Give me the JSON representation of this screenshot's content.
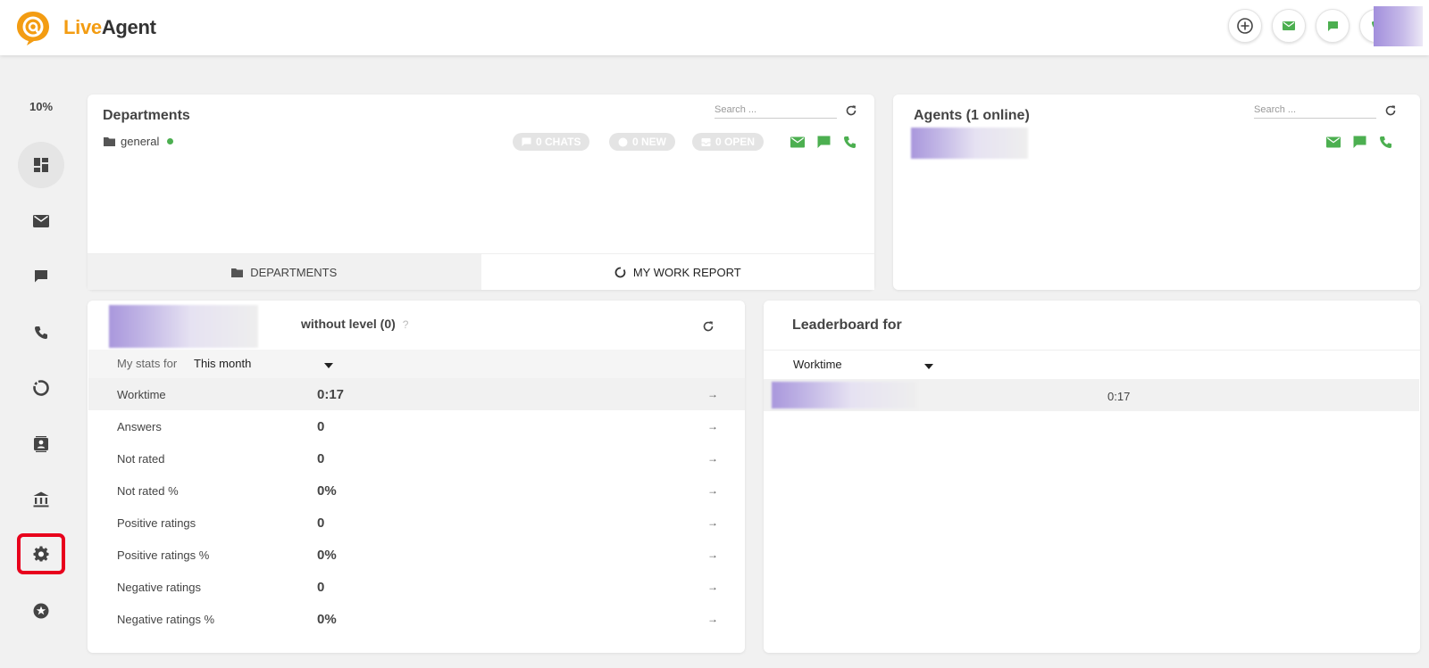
{
  "header": {
    "logo_live": "Live",
    "logo_agent": "Agent",
    "actions": [
      "add-icon",
      "mail-icon",
      "chat-icon",
      "phone-icon"
    ]
  },
  "sidebar": {
    "zoom": "10%",
    "items": [
      {
        "name": "dashboard",
        "icon": "dashboard-icon"
      },
      {
        "name": "tickets",
        "icon": "mail-icon"
      },
      {
        "name": "chats",
        "icon": "chat-icon"
      },
      {
        "name": "calls",
        "icon": "phone-icon"
      },
      {
        "name": "reports",
        "icon": "reports-icon"
      },
      {
        "name": "contacts",
        "icon": "contacts-icon"
      },
      {
        "name": "knowledgebase",
        "icon": "bank-icon"
      },
      {
        "name": "configuration",
        "icon": "gear-icon"
      },
      {
        "name": "plugins",
        "icon": "star-icon"
      }
    ]
  },
  "departments": {
    "title": "Departments",
    "search_placeholder": "Search ...",
    "department_name": "general",
    "chats": "0 CHATS",
    "new": "0 NEW",
    "open": "0 OPEN",
    "tabs": [
      "DEPARTMENTS",
      "MY WORK REPORT"
    ]
  },
  "agents": {
    "title": "Agents (1 online)",
    "search_placeholder": "Search ..."
  },
  "stats": {
    "level": "without level (0)",
    "help": "?",
    "filter_label": "My stats for",
    "filter_value": "This month",
    "rows": [
      {
        "label": "Worktime",
        "value": "0:17"
      },
      {
        "label": "Answers",
        "value": "0"
      },
      {
        "label": "Not rated",
        "value": "0"
      },
      {
        "label": "Not rated %",
        "value": "0%"
      },
      {
        "label": "Positive ratings",
        "value": "0"
      },
      {
        "label": "Positive ratings %",
        "value": "0%"
      },
      {
        "label": "Negative ratings",
        "value": "0"
      },
      {
        "label": "Negative ratings %",
        "value": "0%"
      }
    ],
    "arrow": "→"
  },
  "leaderboard": {
    "title": "Leaderboard for",
    "metric": "Worktime",
    "entry_value": "0:17"
  },
  "colors": {
    "brand_orange": "#f39c12",
    "green": "#4caf50",
    "highlight_red": "#e8001c"
  }
}
